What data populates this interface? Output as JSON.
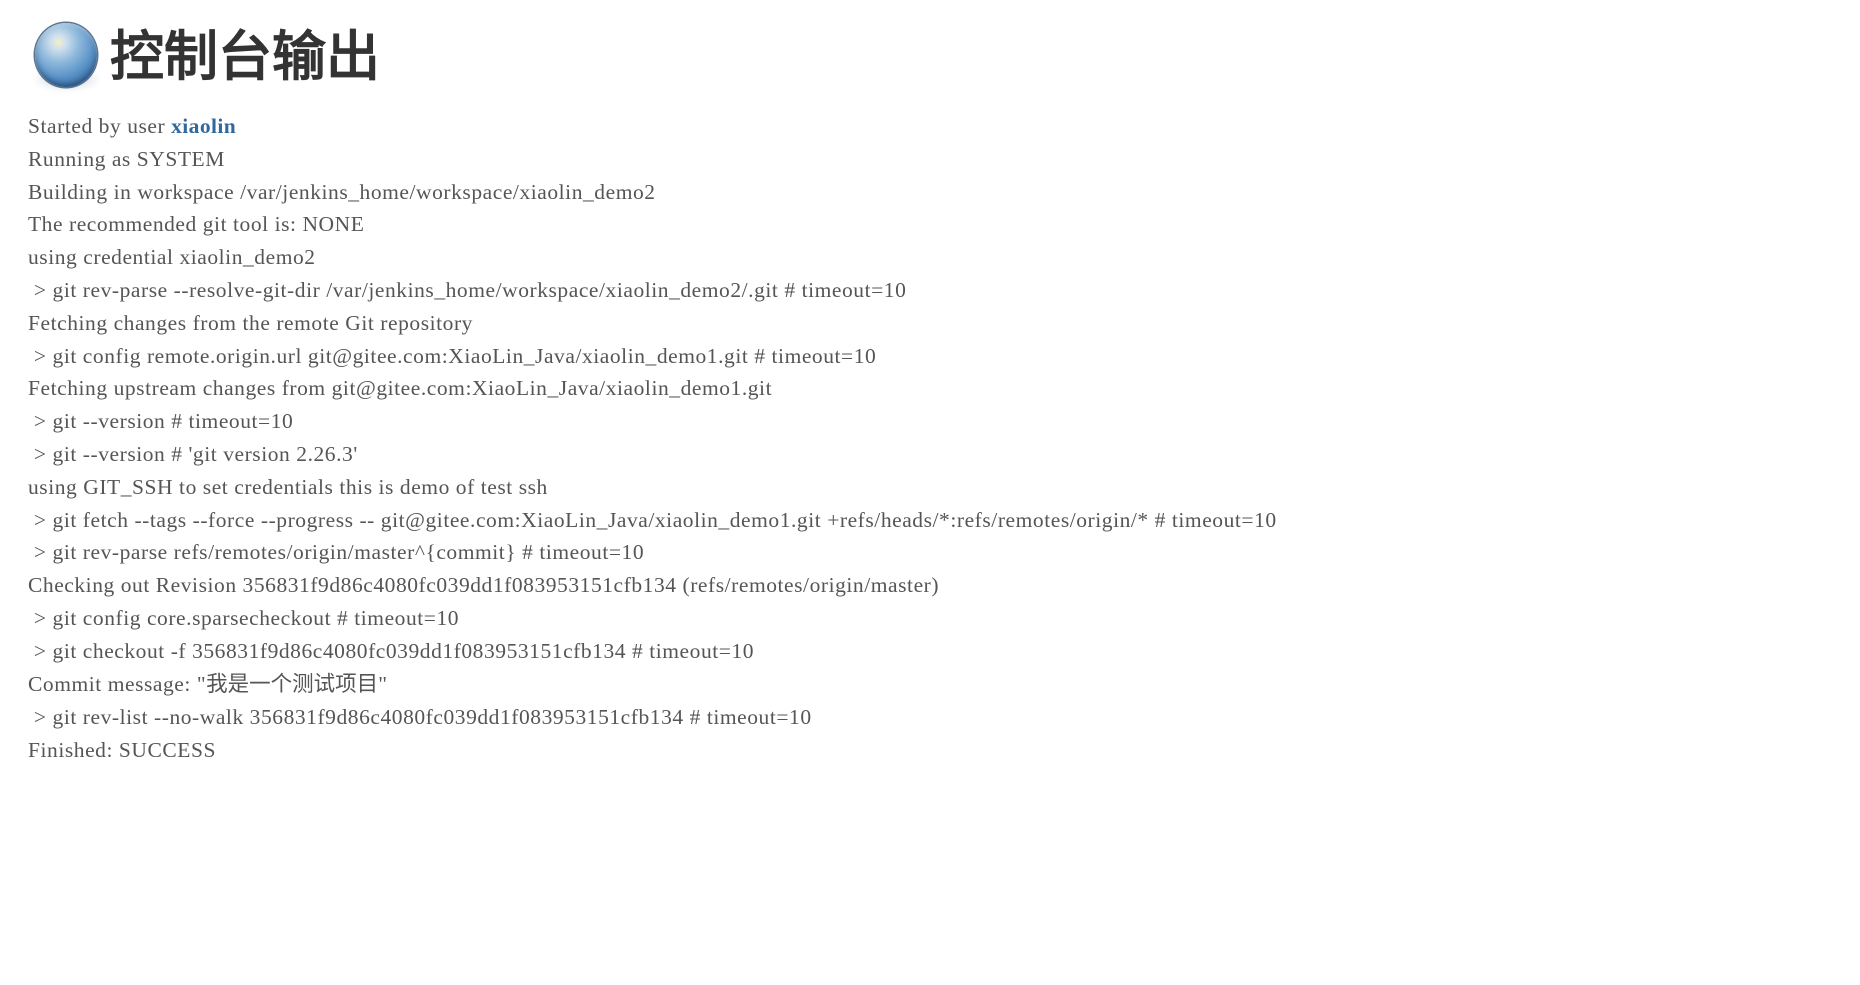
{
  "header": {
    "title": "控制台输出",
    "icon": "blue-sphere-icon",
    "title_color": "#333333"
  },
  "console": {
    "text_color": "#555555",
    "link_color": "#31699c",
    "lines": [
      {
        "id": "started-by-user",
        "prefix": "Started by user ",
        "link": "xiaolin",
        "suffix": ""
      },
      {
        "id": "running-as",
        "text": "Running as SYSTEM"
      },
      {
        "id": "building-in-workspace",
        "text": "Building in workspace /var/jenkins_home/workspace/xiaolin_demo2"
      },
      {
        "id": "recommended-git-tool",
        "text": "The recommended git tool is: NONE"
      },
      {
        "id": "using-credential",
        "text": "using credential xiaolin_demo2"
      },
      {
        "id": "git-rev-parse-resolve-git-dir",
        "text": " > git rev-parse --resolve-git-dir /var/jenkins_home/workspace/xiaolin_demo2/.git # timeout=10"
      },
      {
        "id": "fetching-changes",
        "text": "Fetching changes from the remote Git repository"
      },
      {
        "id": "git-config-remote-origin-url",
        "text": " > git config remote.origin.url git@gitee.com:XiaoLin_Java/xiaolin_demo1.git # timeout=10"
      },
      {
        "id": "fetching-upstream-changes",
        "text": "Fetching upstream changes from git@gitee.com:XiaoLin_Java/xiaolin_demo1.git"
      },
      {
        "id": "git-version-timeout",
        "text": " > git --version # timeout=10"
      },
      {
        "id": "git-version-result",
        "text": " > git --version # 'git version 2.26.3'"
      },
      {
        "id": "using-git-ssh",
        "text": "using GIT_SSH to set credentials this is demo of test ssh"
      },
      {
        "id": "git-fetch-tags",
        "text": " > git fetch --tags --force --progress -- git@gitee.com:XiaoLin_Java/xiaolin_demo1.git +refs/heads/*:refs/remotes/origin/* # timeout=10"
      },
      {
        "id": "git-rev-parse-master",
        "text": " > git rev-parse refs/remotes/origin/master^{commit} # timeout=10"
      },
      {
        "id": "checking-out-revision",
        "text": "Checking out Revision 356831f9d86c4080fc039dd1f083953151cfb134 (refs/remotes/origin/master)"
      },
      {
        "id": "git-config-sparsecheckout",
        "text": " > git config core.sparsecheckout # timeout=10"
      },
      {
        "id": "git-checkout",
        "text": " > git checkout -f 356831f9d86c4080fc039dd1f083953151cfb134 # timeout=10"
      },
      {
        "id": "commit-message",
        "text": "Commit message: \"我是一个测试项目\""
      },
      {
        "id": "git-rev-list",
        "text": " > git rev-list --no-walk 356831f9d86c4080fc039dd1f083953151cfb134 # timeout=10"
      },
      {
        "id": "finished-status",
        "text": "Finished: SUCCESS"
      }
    ]
  }
}
